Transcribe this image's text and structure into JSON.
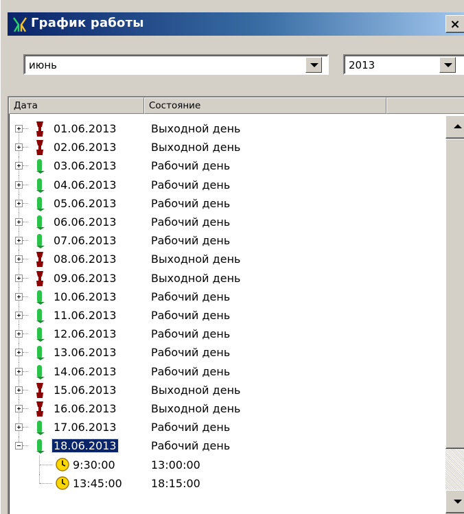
{
  "window": {
    "title": "График работы",
    "close_label": "×"
  },
  "filters": {
    "month": "июнь",
    "year": "2013"
  },
  "columns": {
    "date": "Дата",
    "status": "Состояние"
  },
  "colors": {
    "holiday_icon": "#8b0000",
    "workday_icon": "#2bc24a",
    "selection": "#0a246a",
    "clock": "#ffd800"
  },
  "rows": [
    {
      "date": "01.06.2013",
      "status": "Выходной день",
      "type": "holiday"
    },
    {
      "date": "02.06.2013",
      "status": "Выходной день",
      "type": "holiday"
    },
    {
      "date": "03.06.2013",
      "status": "Рабочий день",
      "type": "workday"
    },
    {
      "date": "04.06.2013",
      "status": "Рабочий день",
      "type": "workday"
    },
    {
      "date": "05.06.2013",
      "status": "Рабочий день",
      "type": "workday"
    },
    {
      "date": "06.06.2013",
      "status": "Рабочий день",
      "type": "workday"
    },
    {
      "date": "07.06.2013",
      "status": "Рабочий день",
      "type": "workday"
    },
    {
      "date": "08.06.2013",
      "status": "Выходной день",
      "type": "holiday"
    },
    {
      "date": "09.06.2013",
      "status": "Выходной день",
      "type": "holiday"
    },
    {
      "date": "10.06.2013",
      "status": "Рабочий день",
      "type": "workday"
    },
    {
      "date": "11.06.2013",
      "status": "Рабочий день",
      "type": "workday"
    },
    {
      "date": "12.06.2013",
      "status": "Рабочий день",
      "type": "workday"
    },
    {
      "date": "13.06.2013",
      "status": "Рабочий день",
      "type": "workday"
    },
    {
      "date": "14.06.2013",
      "status": "Рабочий день",
      "type": "workday"
    },
    {
      "date": "15.06.2013",
      "status": "Выходной день",
      "type": "holiday"
    },
    {
      "date": "16.06.2013",
      "status": "Выходной день",
      "type": "holiday"
    },
    {
      "date": "17.06.2013",
      "status": "Рабочий день",
      "type": "workday"
    },
    {
      "date": "18.06.2013",
      "status": "Рабочий день",
      "type": "workday",
      "selected": true,
      "expanded": true,
      "intervals": [
        {
          "start": "9:30:00",
          "end": "13:00:00"
        },
        {
          "start": "13:45:00",
          "end": "18:15:00"
        }
      ]
    }
  ]
}
